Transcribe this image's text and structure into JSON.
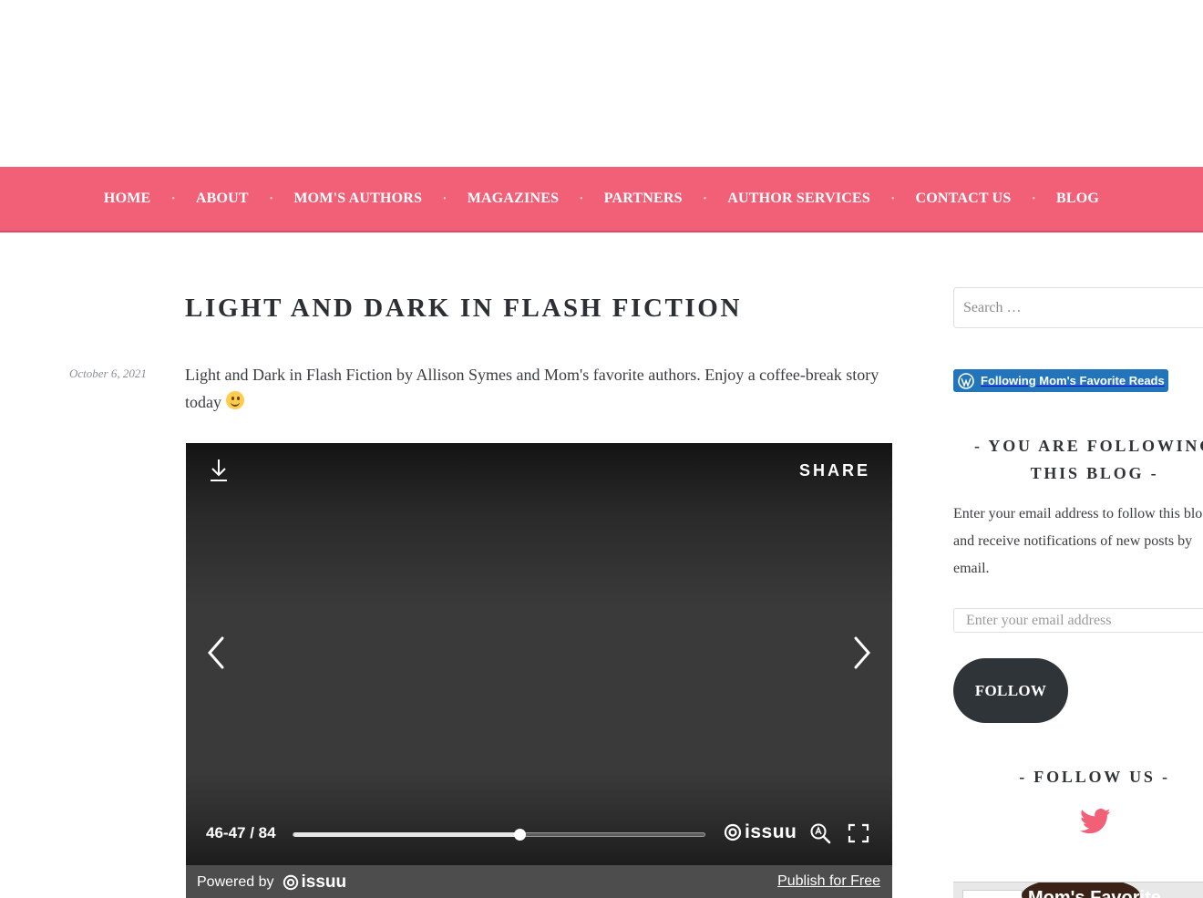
{
  "nav": {
    "items": [
      {
        "label": "HOME"
      },
      {
        "label": "ABOUT"
      },
      {
        "label": "MOM'S AUTHORS"
      },
      {
        "label": "MAGAZINES"
      },
      {
        "label": "PARTNERS"
      },
      {
        "label": "AUTHOR SERVICES"
      },
      {
        "label": "CONTACT US"
      },
      {
        "label": "BLOG"
      }
    ],
    "separator": "•"
  },
  "post": {
    "title": "LIGHT AND DARK IN FLASH FICTION",
    "date": "October 6, 2021",
    "excerpt": "Light and Dark in Flash Fiction by Allison Symes and Mom's favorite authors. Enjoy a coffee-break story today"
  },
  "embed": {
    "share_label": "SHARE",
    "page_count": "46-47 / 84",
    "progress_fraction": 0.55,
    "logo_word": "issuu",
    "powered_by": "Powered by",
    "publish_link": "Publish for Free"
  },
  "sidebar": {
    "search_placeholder": "Search …",
    "wp_follow_label": "Following Mom's Favorite Reads",
    "following_title": "- YOU ARE FOLLOWING THIS BLOG -",
    "following_desc": "Enter your email address to follow this blog and receive notifications of new posts by email.",
    "email_placeholder": "Enter your email address",
    "follow_button": "FOLLOW",
    "follow_us_title": "- FOLLOW US -",
    "fb_page_name": "Mom's Favorite"
  },
  "colors": {
    "nav_bg": "#f26078",
    "wp_blue": "#2375bb",
    "twitter_pink": "#f26078",
    "dark_button": "#2f3438"
  }
}
